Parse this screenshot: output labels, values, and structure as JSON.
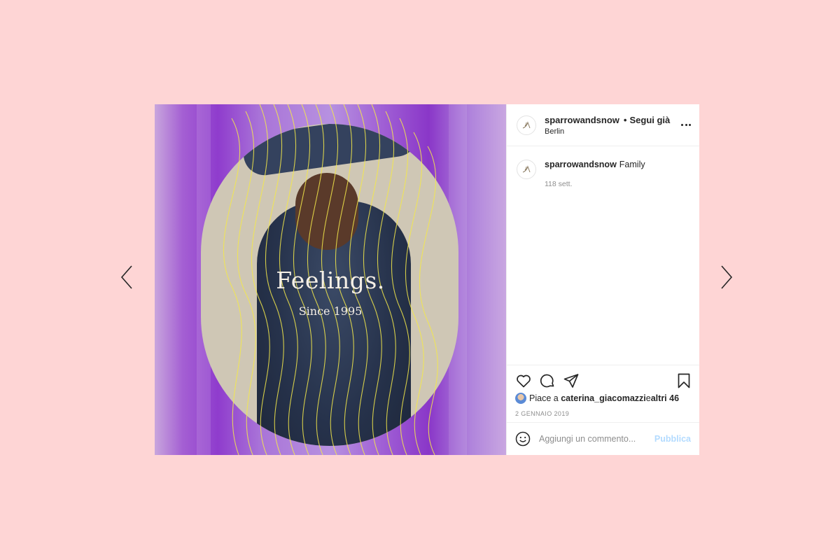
{
  "post": {
    "image": {
      "headline": "Feelings.",
      "subline": "Since 1995"
    },
    "header": {
      "username": "sparrowandsnow",
      "separator": "•",
      "follow_label": "Segui già",
      "location": "Berlin"
    },
    "caption": {
      "username": "sparrowandsnow",
      "text": "Family",
      "time": "118 sett."
    },
    "likes": {
      "prefix": "Piace a ",
      "user": "caterina_giacomazzi",
      "middle": " e ",
      "others": "altri 46"
    },
    "date": "2 GENNAIO 2019",
    "comment_box": {
      "placeholder": "Aggiungi un commento...",
      "submit_label": "Pubblica"
    }
  },
  "colors": {
    "page_background": "#fed5d5",
    "media_purple": "#8f3ccd",
    "accent_yellow": "#f4e94a",
    "publish_disabled": "#b3dbff"
  },
  "icons": {
    "prev": "chevron-left-icon",
    "next": "chevron-right-icon",
    "more": "more-horizontal-icon",
    "like": "heart-icon",
    "comment": "comment-bubble-icon",
    "share": "paper-plane-icon",
    "save": "bookmark-icon",
    "emoji": "smiley-icon"
  }
}
